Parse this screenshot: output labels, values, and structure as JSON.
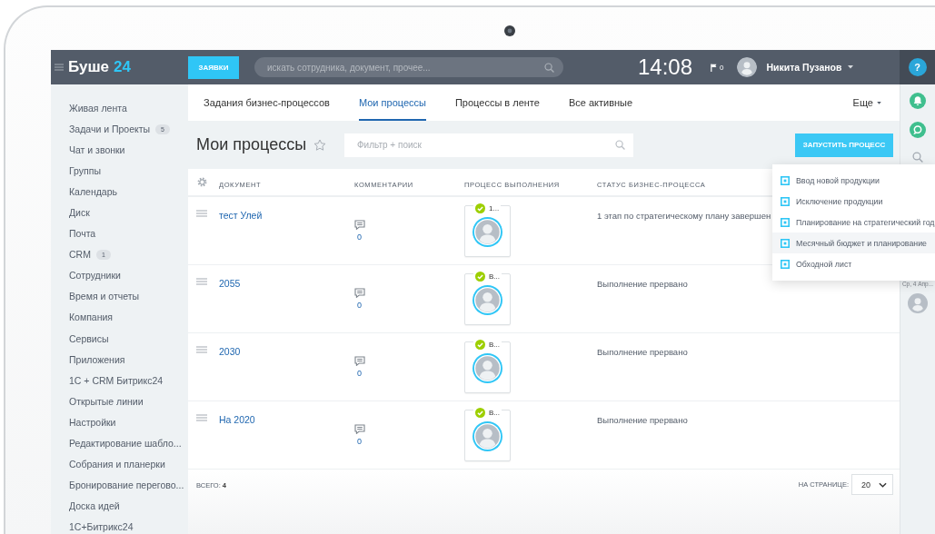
{
  "header": {
    "logo_name": "Буше",
    "logo_number": "24",
    "requests_button": "ЗАЯВКИ",
    "search": {
      "placeholder": "искать сотрудника, документ, прочее..."
    },
    "time": "14:08",
    "flag_count": "0",
    "user_name": "Никита Пузанов",
    "help_button": "?"
  },
  "sidebar": {
    "items": [
      {
        "label": "Живая лента"
      },
      {
        "label": "Задачи и Проекты",
        "counter": "5"
      },
      {
        "label": "Чат и звонки"
      },
      {
        "label": "Группы"
      },
      {
        "label": "Календарь"
      },
      {
        "label": "Диск"
      },
      {
        "label": "Почта"
      },
      {
        "label": "CRM",
        "counter": "1"
      },
      {
        "label": "Сотрудники"
      },
      {
        "label": "Время и отчеты"
      },
      {
        "label": "Компания"
      },
      {
        "label": "Сервисы"
      },
      {
        "label": "Приложения"
      },
      {
        "label": "1С + CRM Битрикс24"
      },
      {
        "label": "Открытые линии"
      },
      {
        "label": "Настройки"
      },
      {
        "label": "Редактирование шабло..."
      },
      {
        "label": "Собрания и планерки"
      },
      {
        "label": "Бронирование перегово..."
      },
      {
        "label": "Доска идей"
      },
      {
        "label": "1С+Битрикс24"
      }
    ]
  },
  "tabs": [
    {
      "label": "Задания бизнес-процессов",
      "selected": false
    },
    {
      "label": "Мои процессы",
      "selected": true
    },
    {
      "label": "Процессы в ленте",
      "selected": false
    },
    {
      "label": "Все активные",
      "selected": false
    }
  ],
  "more_button": "Еще",
  "page_title": "Мои процессы",
  "starred": false,
  "filter": {
    "placeholder": "Фильтр + поиск"
  },
  "start_button": "ЗАПУСТИТЬ ПРОЦЕСС",
  "process_menu": {
    "items": [
      {
        "label": "Ввод новой продукции",
        "selected": false
      },
      {
        "label": "Исключение продукции",
        "selected": false
      },
      {
        "label": "Планирование на стратегический год",
        "selected": false
      },
      {
        "label": "Месячный бюджет и планирование",
        "selected": true
      },
      {
        "label": "Обходной лист",
        "selected": false
      }
    ]
  },
  "table": {
    "columns": [
      "ДОКУМЕНТ",
      "КОММЕНТАРИИ",
      "ПРОЦЕСС ВЫПОЛНЕНИЯ",
      "СТАТУС БИЗНЕС-ПРОЦЕССА"
    ],
    "rows": [
      {
        "document": "тест Улей",
        "comments": "0",
        "step": "1...",
        "completed": true,
        "status": "1 этап по стратегическому плану завершен"
      },
      {
        "document": "2055",
        "comments": "0",
        "step": "В...",
        "completed": true,
        "status": "Выполнение прервано"
      },
      {
        "document": "2030",
        "comments": "0",
        "step": "В...",
        "completed": true,
        "status": "Выполнение прервано"
      },
      {
        "document": "На 2020",
        "comments": "0",
        "step": "В...",
        "completed": true,
        "status": "Выполнение прервано"
      }
    ]
  },
  "footer": {
    "total": "ВСЕГО: **4**",
    "page_size_label": "НА СТРАНИЦЕ:",
    "page_size": "20"
  },
  "right_panel": {
    "date": "Ср, 4 Апр..."
  }
}
